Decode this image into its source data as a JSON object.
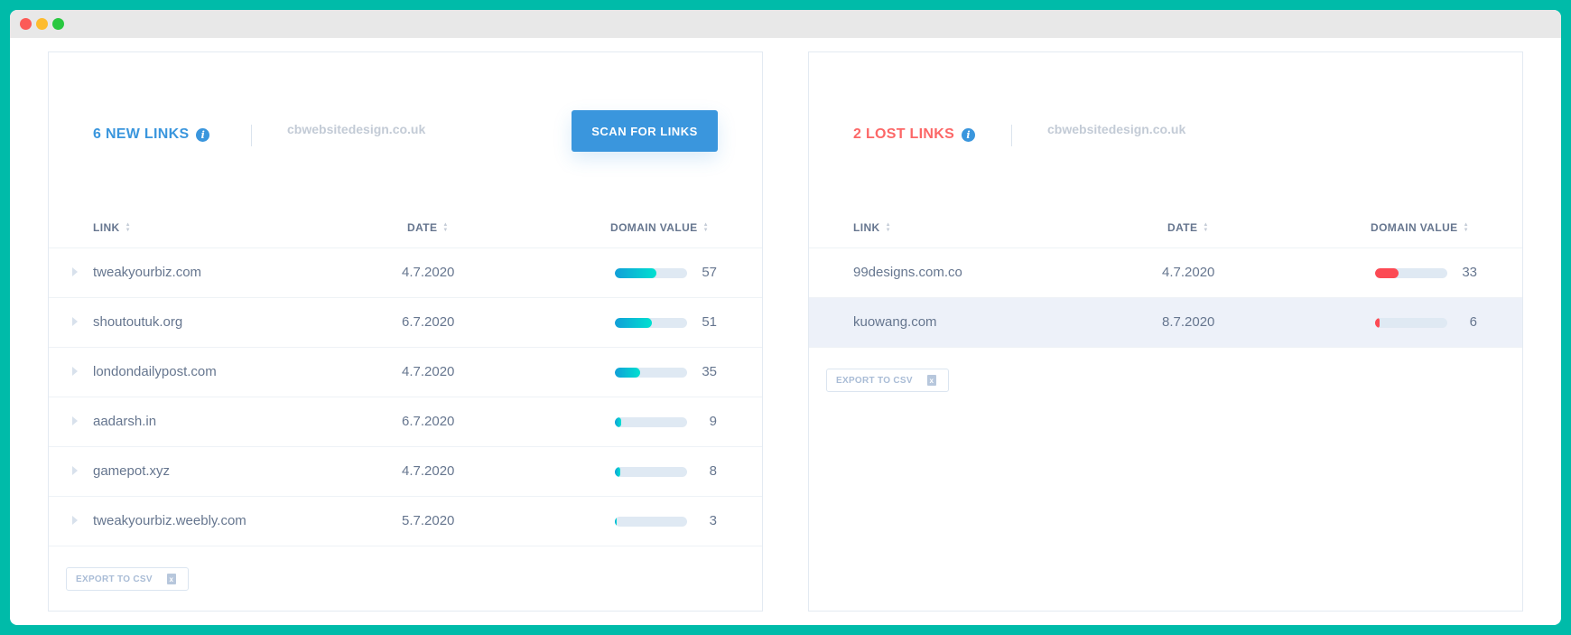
{
  "colors": {
    "accent": "#3a96dd",
    "lost": "#fc6767",
    "new_bar_start": "#119fd8",
    "new_bar_end": "#00e0d0",
    "lost_bar": "#fc4a54"
  },
  "new_links": {
    "title": "6 NEW LINKS",
    "domain": "cbwebsitedesign.co.uk",
    "scan_label": "SCAN FOR LINKS",
    "columns": [
      "LINK",
      "DATE",
      "DOMAIN VALUE"
    ],
    "rows": [
      {
        "link": "tweakyourbiz.com",
        "date": "4.7.2020",
        "value": 57
      },
      {
        "link": "shoutoutuk.org",
        "date": "6.7.2020",
        "value": 51
      },
      {
        "link": "londondailypost.com",
        "date": "4.7.2020",
        "value": 35
      },
      {
        "link": "aadarsh.in",
        "date": "6.7.2020",
        "value": 9
      },
      {
        "link": "gamepot.xyz",
        "date": "4.7.2020",
        "value": 8
      },
      {
        "link": "tweakyourbiz.weebly.com",
        "date": "5.7.2020",
        "value": 3
      }
    ],
    "export_label": "EXPORT TO CSV"
  },
  "lost_links": {
    "title": "2 LOST LINKS",
    "domain": "cbwebsitedesign.co.uk",
    "columns": [
      "LINK",
      "DATE",
      "DOMAIN VALUE"
    ],
    "rows": [
      {
        "link": "99designs.com.co",
        "date": "4.7.2020",
        "value": 33
      },
      {
        "link": "kuowang.com",
        "date": "8.7.2020",
        "value": 6,
        "hovered": true
      }
    ],
    "export_label": "EXPORT TO CSV"
  }
}
